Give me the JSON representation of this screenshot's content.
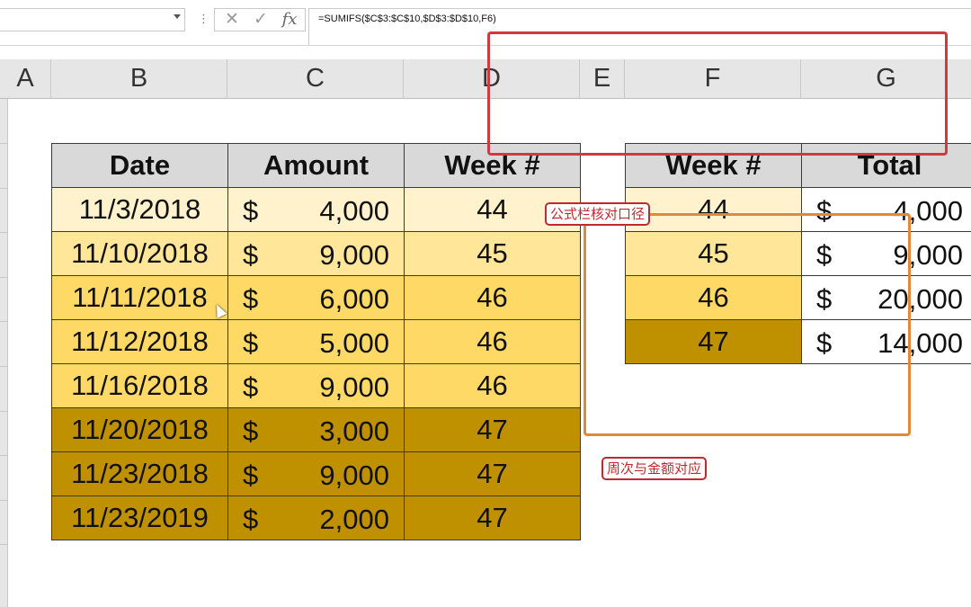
{
  "formula_bar": {
    "namebox_value": "",
    "formula": "=SUMIFS($C$3:$C$10,$D$3:$D$10,F6)",
    "icons": [
      "cancel-icon",
      "enter-icon",
      "fx-icon"
    ]
  },
  "columns": [
    "A",
    "B",
    "C",
    "D",
    "E",
    "F",
    "G"
  ],
  "main_table": {
    "headers": [
      "Date",
      "Amount",
      "Week #"
    ],
    "rows": [
      {
        "date": "11/3/2018",
        "currency": "$",
        "amount": "4,000",
        "week": "44",
        "color": "#fff2cc"
      },
      {
        "date": "11/10/2018",
        "currency": "$",
        "amount": "9,000",
        "week": "45",
        "color": "#ffe699"
      },
      {
        "date": "11/11/2018",
        "currency": "$",
        "amount": "6,000",
        "week": "46",
        "color": "#ffd966"
      },
      {
        "date": "11/12/2018",
        "currency": "$",
        "amount": "5,000",
        "week": "46",
        "color": "#ffd966"
      },
      {
        "date": "11/16/2018",
        "currency": "$",
        "amount": "9,000",
        "week": "46",
        "color": "#ffd966"
      },
      {
        "date": "11/20/2018",
        "currency": "$",
        "amount": "3,000",
        "week": "47",
        "color": "#bf9000"
      },
      {
        "date": "11/23/2018",
        "currency": "$",
        "amount": "9,000",
        "week": "47",
        "color": "#bf9000"
      },
      {
        "date": "11/23/2019",
        "currency": "$",
        "amount": "2,000",
        "week": "47",
        "color": "#bf9000"
      }
    ]
  },
  "summary_table": {
    "headers": [
      "Week #",
      "Total"
    ],
    "rows": [
      {
        "week": "44",
        "currency": "$",
        "total": "4,000",
        "color": "#fff2cc"
      },
      {
        "week": "45",
        "currency": "$",
        "total": "9,000",
        "color": "#ffe699"
      },
      {
        "week": "46",
        "currency": "$",
        "total": "20,000",
        "color": "#ffd966"
      },
      {
        "week": "47",
        "currency": "$",
        "total": "14,000",
        "color": "#bf9000"
      }
    ]
  },
  "annotations": {
    "formula_label": "公式栏核对口径",
    "week_label": "周次与金额对应"
  }
}
